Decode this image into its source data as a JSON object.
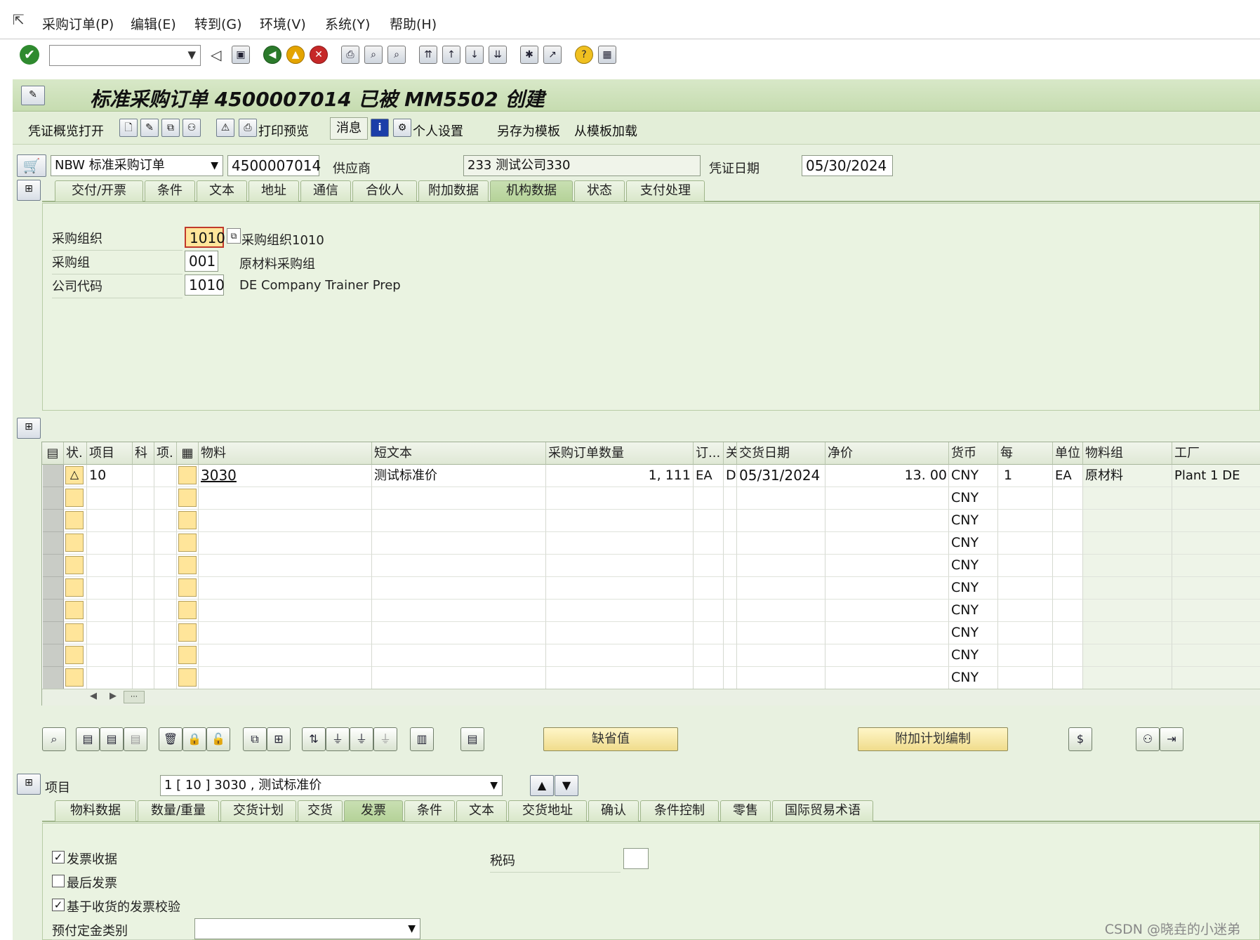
{
  "menu": {
    "items": [
      "采购订单(P)",
      "编辑(E)",
      "转到(G)",
      "环境(V)",
      "系统(Y)",
      "帮助(H)"
    ]
  },
  "toolbar": {
    "command_field_value": ""
  },
  "title": {
    "text": "标准采购订单 4500007014 已被 MM5502 创建"
  },
  "appbar": {
    "doc_overview": "凭证概览打开",
    "print_preview": "打印预览",
    "messages": "消息",
    "personal_settings": "个人设置",
    "save_as_template": "另存为模板",
    "load_from_template": "从模板加载"
  },
  "header": {
    "doc_type": "NBW 标准采购订单",
    "po_number": "4500007014",
    "vendor_label": "供应商",
    "vendor_value": "233 测试公司330",
    "doc_date_label": "凭证日期",
    "doc_date_value": "05/30/2024"
  },
  "header_tabs": [
    "交付/开票",
    "条件",
    "文本",
    "地址",
    "通信",
    "合伙人",
    "附加数据",
    "机构数据",
    "状态",
    "支付处理"
  ],
  "header_tab_active": "机构数据",
  "org_data": {
    "purch_org_label": "采购组织",
    "purch_org_value": "1010",
    "purch_org_desc": "采购组织1010",
    "purch_group_label": "采购组",
    "purch_group_value": "001",
    "purch_group_desc": "原材料采购组",
    "company_code_label": "公司代码",
    "company_code_value": "1010",
    "company_code_desc": "DE Company Trainer Prep"
  },
  "items_table": {
    "columns": [
      "状.",
      "项目",
      "科",
      "项.",
      "",
      "物料",
      "短文本",
      "采购订单数量",
      "订...",
      "关",
      "交货日期",
      "净价",
      "货币",
      "每",
      "单位",
      "物料组",
      "工厂"
    ],
    "row": {
      "status": "△",
      "item": "10",
      "material": "3030",
      "short_text": "测试标准价",
      "quantity": "1, 111",
      "oun": "EA",
      "cat": "D",
      "delivery_date": "05/31/2024",
      "net_price": "13. 00",
      "currency": "CNY",
      "per": "1",
      "unit": "EA",
      "material_group": "原材料",
      "plant": "Plant 1 DE"
    },
    "empty_currency": "CNY"
  },
  "buttons": {
    "defaults": "缺省值",
    "addl_planning": "附加计划编制"
  },
  "item_selector": {
    "label": "项目",
    "value": "1 [ 10 ] 3030 , 测试标准价"
  },
  "item_tabs": [
    "物料数据",
    "数量/重量",
    "交货计划",
    "交货",
    "发票",
    "条件",
    "文本",
    "交货地址",
    "确认",
    "条件控制",
    "零售",
    "国际贸易术语"
  ],
  "item_tab_active": "发票",
  "invoice": {
    "inv_receipt": "发票收据",
    "final_invoice": "最后发票",
    "gr_based_iv": "基于收货的发票校验",
    "dp_category": "预付定金类别",
    "tax_code": "税码"
  },
  "watermark": "CSDN @晓垚的小迷弟",
  "colors": {
    "title_bg": "#c6dcb0",
    "panel_bg": "#eaf3e1",
    "required_yellow": "#ffe59a"
  }
}
